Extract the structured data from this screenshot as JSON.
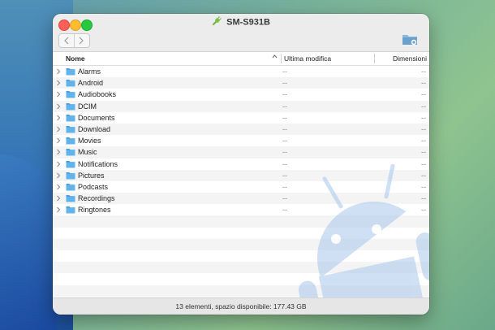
{
  "window": {
    "title": "SM-S931B"
  },
  "toolbar": {
    "back": "back",
    "forward": "forward",
    "new_folder": "new-folder"
  },
  "columns": {
    "name": "Nome",
    "modified": "Ultima modifica",
    "size": "Dimensioni"
  },
  "files": [
    {
      "name": "Alarms",
      "modified": "--",
      "size": "--"
    },
    {
      "name": "Android",
      "modified": "--",
      "size": "--"
    },
    {
      "name": "Audiobooks",
      "modified": "--",
      "size": "--"
    },
    {
      "name": "DCIM",
      "modified": "--",
      "size": "--"
    },
    {
      "name": "Documents",
      "modified": "--",
      "size": "--"
    },
    {
      "name": "Download",
      "modified": "--",
      "size": "--"
    },
    {
      "name": "Movies",
      "modified": "--",
      "size": "--"
    },
    {
      "name": "Music",
      "modified": "--",
      "size": "--"
    },
    {
      "name": "Notifications",
      "modified": "--",
      "size": "--"
    },
    {
      "name": "Pictures",
      "modified": "--",
      "size": "--"
    },
    {
      "name": "Podcasts",
      "modified": "--",
      "size": "--"
    },
    {
      "name": "Recordings",
      "modified": "--",
      "size": "--"
    },
    {
      "name": "Ringtones",
      "modified": "--",
      "size": "--"
    }
  ],
  "status": {
    "text": "13 elementi, spazio disponibile: 177.43 GB"
  },
  "colors": {
    "folder": "#62b3ec",
    "android_watermark": "#a9c8ec"
  }
}
